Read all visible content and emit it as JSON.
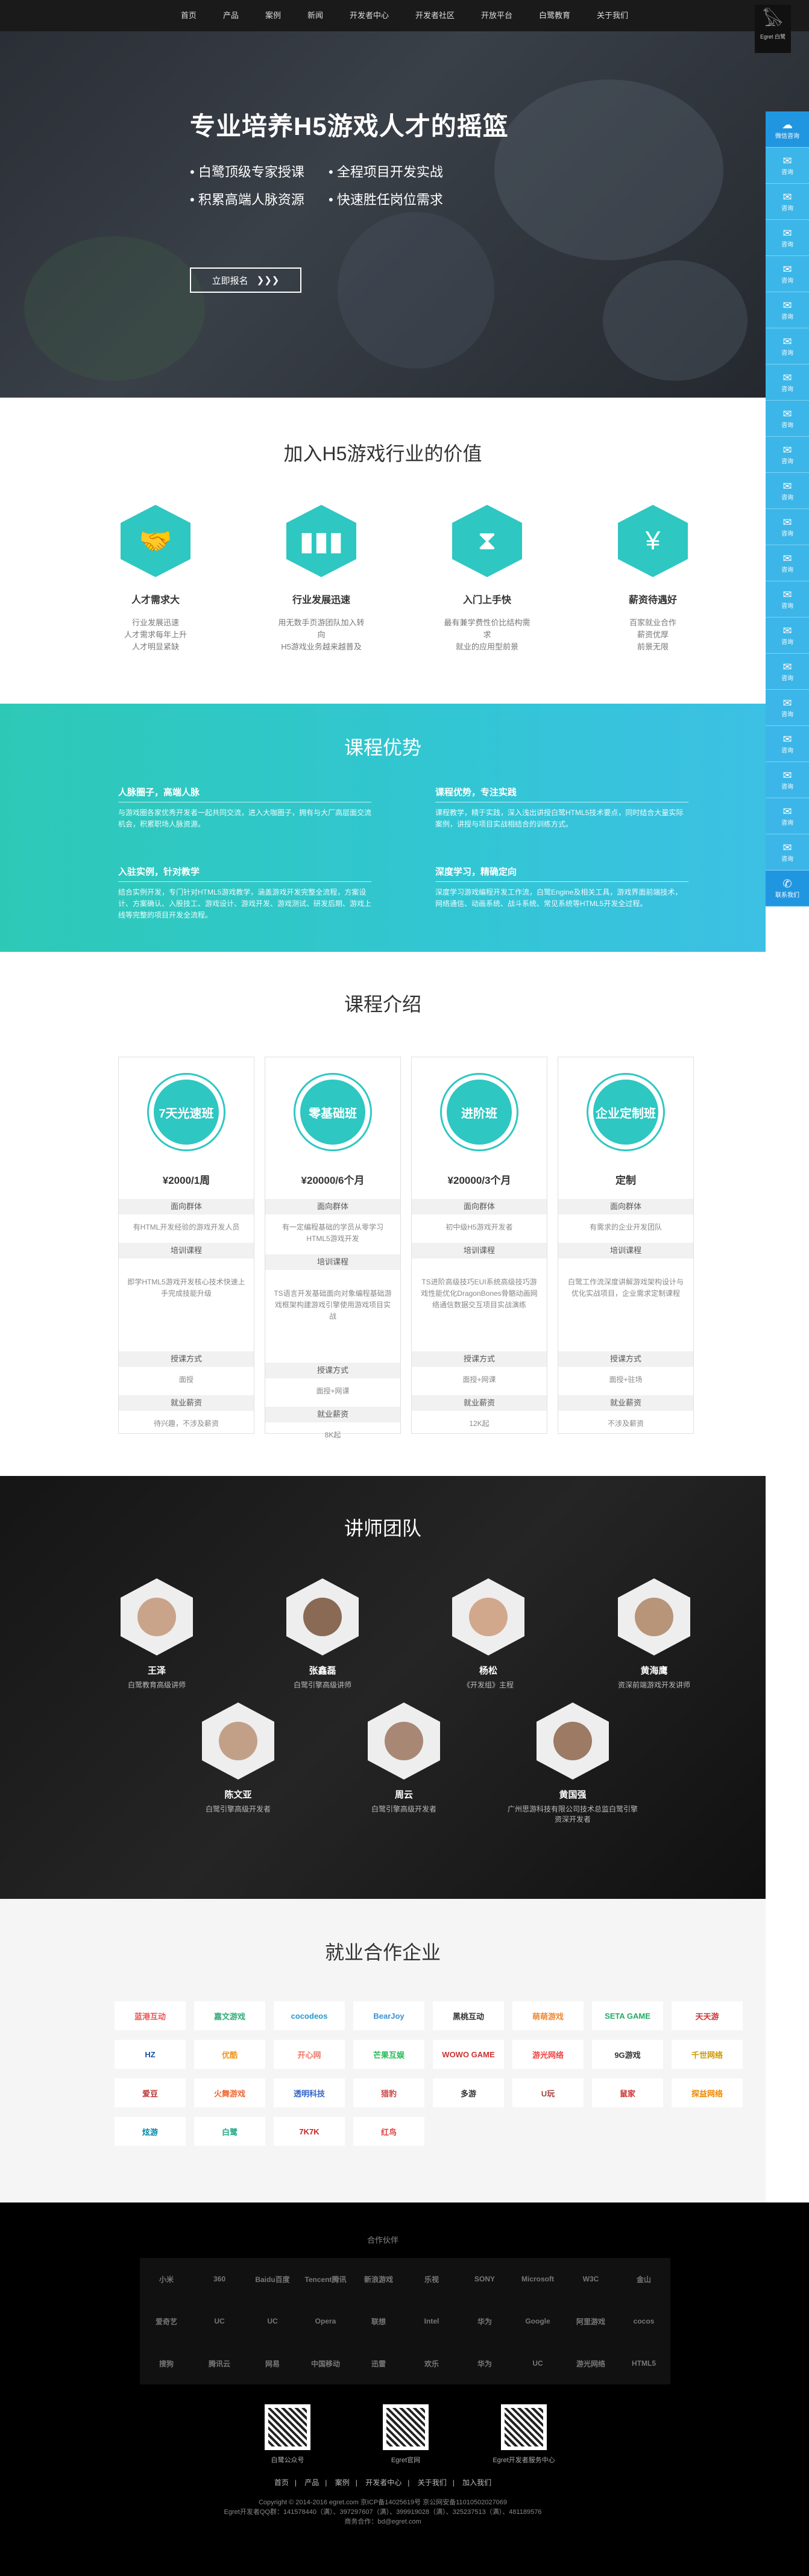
{
  "nav": {
    "items": [
      "首页",
      "产品",
      "案例",
      "新闻",
      "开发者中心",
      "开发者社区",
      "开放平台",
      "白鹭教育",
      "关于我们"
    ]
  },
  "brand": {
    "name": "Egret 白鹭"
  },
  "hero": {
    "title": "专业培养H5游戏人才的摇篮",
    "bullets": [
      "• 白鹭顶级专家授课",
      "• 全程项目开发实战",
      "• 积累高端人脉资源",
      "• 快速胜任岗位需求"
    ],
    "button": "立即报名",
    "button_icon": "chevrons-right-icon"
  },
  "sidebar": {
    "top": "微信咨询",
    "item": "咨询",
    "bottom": "联系我们"
  },
  "values": {
    "title": "加入H5游戏行业的价值",
    "items": [
      {
        "icon": "handshake-icon",
        "name": "人才需求大",
        "desc": [
          "行业发展迅速",
          "人才需求每年上升",
          "人才明显紧缺"
        ]
      },
      {
        "icon": "bar-chart-icon",
        "name": "行业发展迅速",
        "desc": [
          "用无数手页游团队加入转向",
          "H5游戏业务越来越普及"
        ]
      },
      {
        "icon": "hourglass-icon",
        "name": "入门上手快",
        "desc": [
          "最有兼学费性价比结构需求",
          "就业的应用型前景"
        ]
      },
      {
        "icon": "money-icon",
        "name": "薪资待遇好",
        "desc": [
          "百家就业合作",
          "薪资优厚",
          "前景无限"
        ]
      }
    ]
  },
  "advantage": {
    "title": "课程优势",
    "blocks": [
      {
        "h": "人脉圈子，高端人脉",
        "p": "与游戏圈各家优秀开发者一起共同交流，进入大咖圈子，拥有与大厂高层面交流机会，积累职场人脉资源。"
      },
      {
        "h": "课程优势，专注实践",
        "p": "课程教学，精于实践，深入浅出讲授白鹭HTML5技术要点，同时结合大量实际案例，讲授与项目实战相结合的训练方式。"
      },
      {
        "h": "入驻实例，针对教学",
        "p": "结合实例开发，专门针对HTML5游戏教学，涵盖游戏开发完整全流程，方案设计、方案确认、入股技工、游戏设计、游戏开发、游戏测试、研发后期、游戏上线等完整的项目开发全流程。"
      },
      {
        "h": "深度学习，精确定向",
        "p": "深度学习游戏编程开发工作流，白鹭Engine及相关工具，游戏界面前端技术，网络通信、动画系统、战斗系统、常见系统等HTML5开发全过程。"
      }
    ]
  },
  "courses": {
    "title": "课程介绍",
    "labels": {
      "audience": "面向群体",
      "content": "培训课程",
      "mode": "授课方式",
      "job": "就业薪资"
    },
    "items": [
      {
        "name": "7天光速班",
        "price": "¥2000/1周",
        "audience": "有HTML开发经验的游戏开发人员",
        "content": "即学HTML5游戏开发核心技术快速上手完成技能升级",
        "mode": "面授",
        "job": "待兴趣，不涉及薪资"
      },
      {
        "name": "零基础班",
        "price": "¥20000/6个月",
        "audience": "有一定编程基础的学员从零学习HTML5游戏开发",
        "content": "TS语言开发基础面向对象编程基础游戏框架构建游戏引擎使用游戏项目实战",
        "mode": "面授+网课",
        "job": "8K起"
      },
      {
        "name": "进阶班",
        "price": "¥20000/3个月",
        "audience": "初中级H5游戏开发者",
        "content": "TS进阶高级技巧EUI系统高级技巧游戏性能优化DragonBones骨骼动画网络通信数据交互项目实战演练",
        "mode": "面授+网课",
        "job": "12K起"
      },
      {
        "name": "企业定制班",
        "price": "定制",
        "audience": "有需求的企业开发团队",
        "content": "白鹭工作流深度讲解游戏架构设计与优化实战项目，企业需求定制课程",
        "mode": "面授+驻场",
        "job": "不涉及薪资"
      }
    ]
  },
  "teachers": {
    "title": "讲师团队",
    "items": [
      {
        "name": "王泽",
        "role": "白鹭教育高级讲师"
      },
      {
        "name": "张鑫磊",
        "role": "白鹭引擎高级讲师"
      },
      {
        "name": "杨松",
        "role": "《开发组》主程"
      },
      {
        "name": "黄海鹰",
        "role": "资深前端游戏开发讲师"
      },
      {
        "name": "陈文亚",
        "role": "白鹭引擎高级开发者"
      },
      {
        "name": "周云",
        "role": "白鹭引擎高级开发者"
      },
      {
        "name": "黄国强",
        "role": "广州思游科技有限公司技术总监白鹭引擎资深开发者"
      }
    ]
  },
  "partners": {
    "title": "就业合作企业",
    "logos": [
      "蓝港互动",
      "嘉文游戏",
      "cocodeos",
      "BearJoy",
      "黑桃互动",
      "萌萌游戏",
      "SETA GAME",
      "天天游",
      "HZ",
      "优酷",
      "开心网",
      "芒果互娱",
      "WOWO GAME",
      "游光网络",
      "9G游戏",
      "千世网络",
      "爱豆",
      "火舞游戏",
      "透明科技",
      "猎豹",
      "多游",
      "U玩",
      "鼠家",
      "探益网络",
      "炫游",
      "白鹭",
      "7K7K",
      "红鸟"
    ]
  },
  "footer": {
    "label": "合作伙伴",
    "logos": [
      "小米",
      "360",
      "Baidu百度",
      "Tencent腾讯",
      "新浪游戏",
      "乐视",
      "SONY",
      "Microsoft",
      "W3C",
      "金山",
      "爱奇艺",
      "UC",
      "UC",
      "Opera",
      "联想",
      "Intel",
      "华为",
      "Google",
      "阿里游戏",
      "cocos",
      "搜狗",
      "腾讯云",
      "网易",
      "中国移动",
      "迅雷",
      "欢乐",
      "华为",
      "UC",
      "游光网络",
      "HTML5"
    ],
    "qr": [
      {
        "label": "白鹭公众号"
      },
      {
        "label": "Egret官网"
      },
      {
        "label": "Egret开发者服务中心"
      }
    ],
    "nav": [
      "首页",
      "产品",
      "案例",
      "开发者中心",
      "关于我们",
      "加入我们"
    ],
    "copy": [
      "Copyright © 2014-2016 egret.com 京ICP备14025619号 京公网安备11010502027069",
      "Egret开发者QQ群：141578440（满）、397297607（满）、399919028（满）、325237513（满）、481189576",
      "商务合作：bd@egret.com"
    ]
  }
}
